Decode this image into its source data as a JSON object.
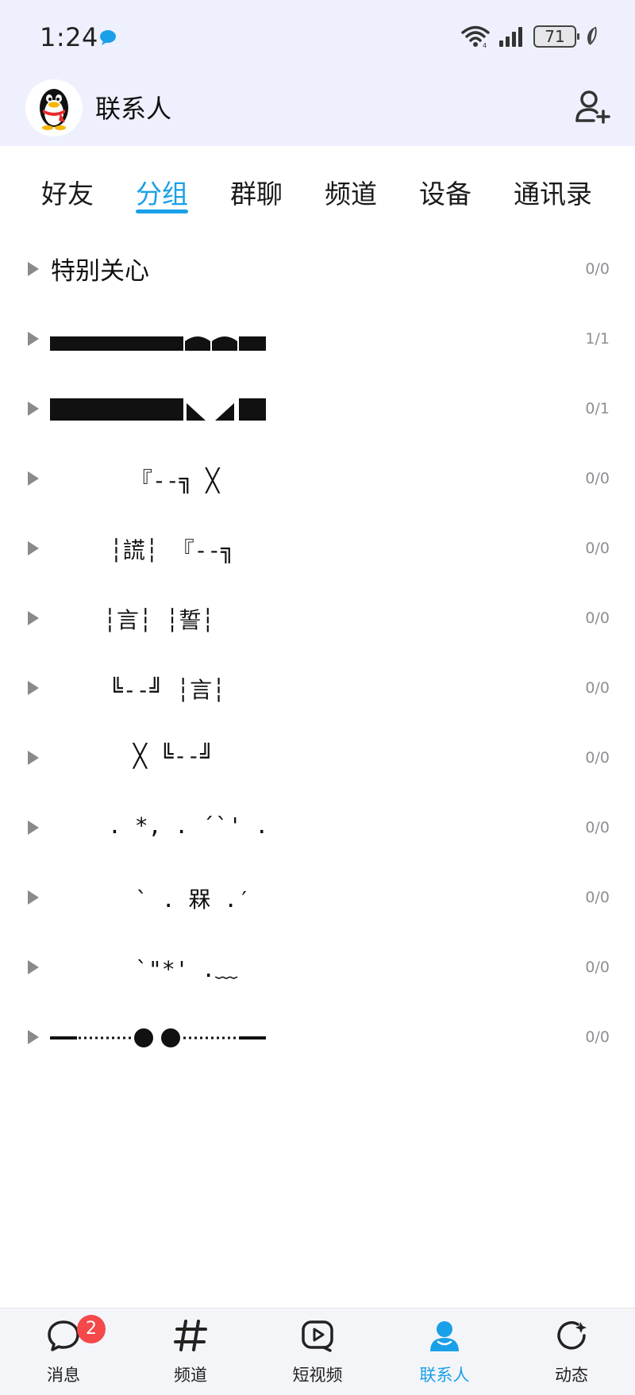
{
  "status_bar": {
    "time": "1:24",
    "battery": "71"
  },
  "header": {
    "title": "联系人"
  },
  "tabs": [
    {
      "label": "好友"
    },
    {
      "label": "分组"
    },
    {
      "label": "群聊"
    },
    {
      "label": "频道"
    },
    {
      "label": "设备"
    },
    {
      "label": "通讯录"
    }
  ],
  "groups": [
    {
      "name": "特别关心",
      "count": "0/0"
    },
    {
      "name": "",
      "count": "1/1"
    },
    {
      "name": "",
      "count": "0/1"
    },
    {
      "name": "『--╗ ╳",
      "count": "0/0"
    },
    {
      "name": "┆謊┆ 『--╗",
      "count": "0/0"
    },
    {
      "name": "┆言┆ ┆誓┆",
      "count": "0/0"
    },
    {
      "name": "╚--╝ ┆言┆",
      "count": "0/0"
    },
    {
      "name": "╳ ╚--╝",
      "count": "0/0"
    },
    {
      "name": ". *, . ´`' .",
      "count": "0/0"
    },
    {
      "name": "` . 槑 .′",
      "count": "0/0"
    },
    {
      "name": "`\"*' .﹏",
      "count": "0/0"
    },
    {
      "name": "",
      "count": "0/0"
    }
  ],
  "bottom_nav": [
    {
      "label": "消息",
      "badge": "2"
    },
    {
      "label": "频道"
    },
    {
      "label": "短视频"
    },
    {
      "label": "联系人"
    },
    {
      "label": "动态"
    }
  ],
  "colors": {
    "accent": "#1aa0e8",
    "badge": "#f4484a",
    "header_bg": "#eef1fd"
  }
}
